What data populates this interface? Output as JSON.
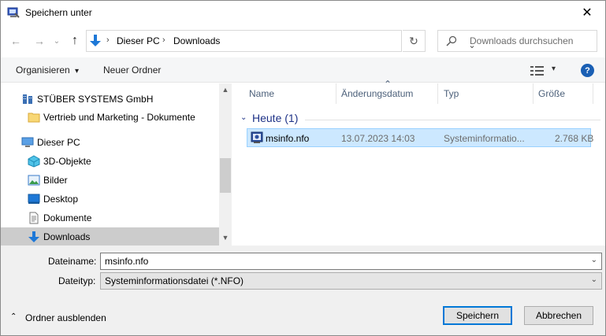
{
  "window": {
    "title": "Speichern unter",
    "close_glyph": "✕"
  },
  "nav": {
    "back_glyph": "←",
    "forward_glyph": "→",
    "recent_glyph": "⌄",
    "up_glyph": "↑",
    "breadcrumbs": [
      "Dieser PC",
      "Downloads"
    ],
    "sep_glyph": "›",
    "dropdown_glyph": "⌄",
    "refresh_glyph": "↻",
    "search_placeholder": "Downloads durchsuchen"
  },
  "toolbar": {
    "organize_label": "Organisieren",
    "organize_glyph": "▾",
    "new_folder_label": "Neuer Ordner",
    "view_glyph": "▾",
    "help_glyph": "?"
  },
  "sidebar": {
    "items": [
      {
        "label": "STÜBER SYSTEMS GmbH",
        "icon": "onedrive-business-icon"
      },
      {
        "label": "Vertrieb und Marketing - Dokumente",
        "icon": "folder-icon"
      },
      {
        "label": "Dieser PC",
        "icon": "pc-icon"
      },
      {
        "label": "3D-Objekte",
        "icon": "3d-objects-icon"
      },
      {
        "label": "Bilder",
        "icon": "pictures-icon"
      },
      {
        "label": "Desktop",
        "icon": "desktop-icon"
      },
      {
        "label": "Dokumente",
        "icon": "documents-icon"
      },
      {
        "label": "Downloads",
        "icon": "downloads-icon",
        "selected": true
      }
    ],
    "scroll_up_glyph": "▲",
    "scroll_down_glyph": "▼"
  },
  "content": {
    "columns": [
      "Name",
      "Änderungsdatum",
      "Typ",
      "Größe"
    ],
    "sort_glyph": "⌃",
    "group": {
      "chevron": "⌄",
      "label": "Heute (1)"
    },
    "files": [
      {
        "name": "msinfo.nfo",
        "date": "13.07.2023 14:03",
        "type": "Systeminformatio...",
        "size": "2.768 KB"
      }
    ]
  },
  "form": {
    "filename_label": "Dateiname:",
    "filename_value": "msinfo.nfo",
    "filetype_label": "Dateityp:",
    "filetype_value": "Systeminformationsdatei (*.NFO)",
    "dropdown_glyph": "⌄",
    "hide_folders_label": "Ordner ausblenden",
    "hide_folders_glyph": "⌃",
    "save_label": "Speichern",
    "cancel_label": "Abbrechen"
  },
  "colors": {
    "accent": "#0078d7",
    "selection": "#cce8ff",
    "group": "#1e3287",
    "header_text": "#4c607a"
  }
}
